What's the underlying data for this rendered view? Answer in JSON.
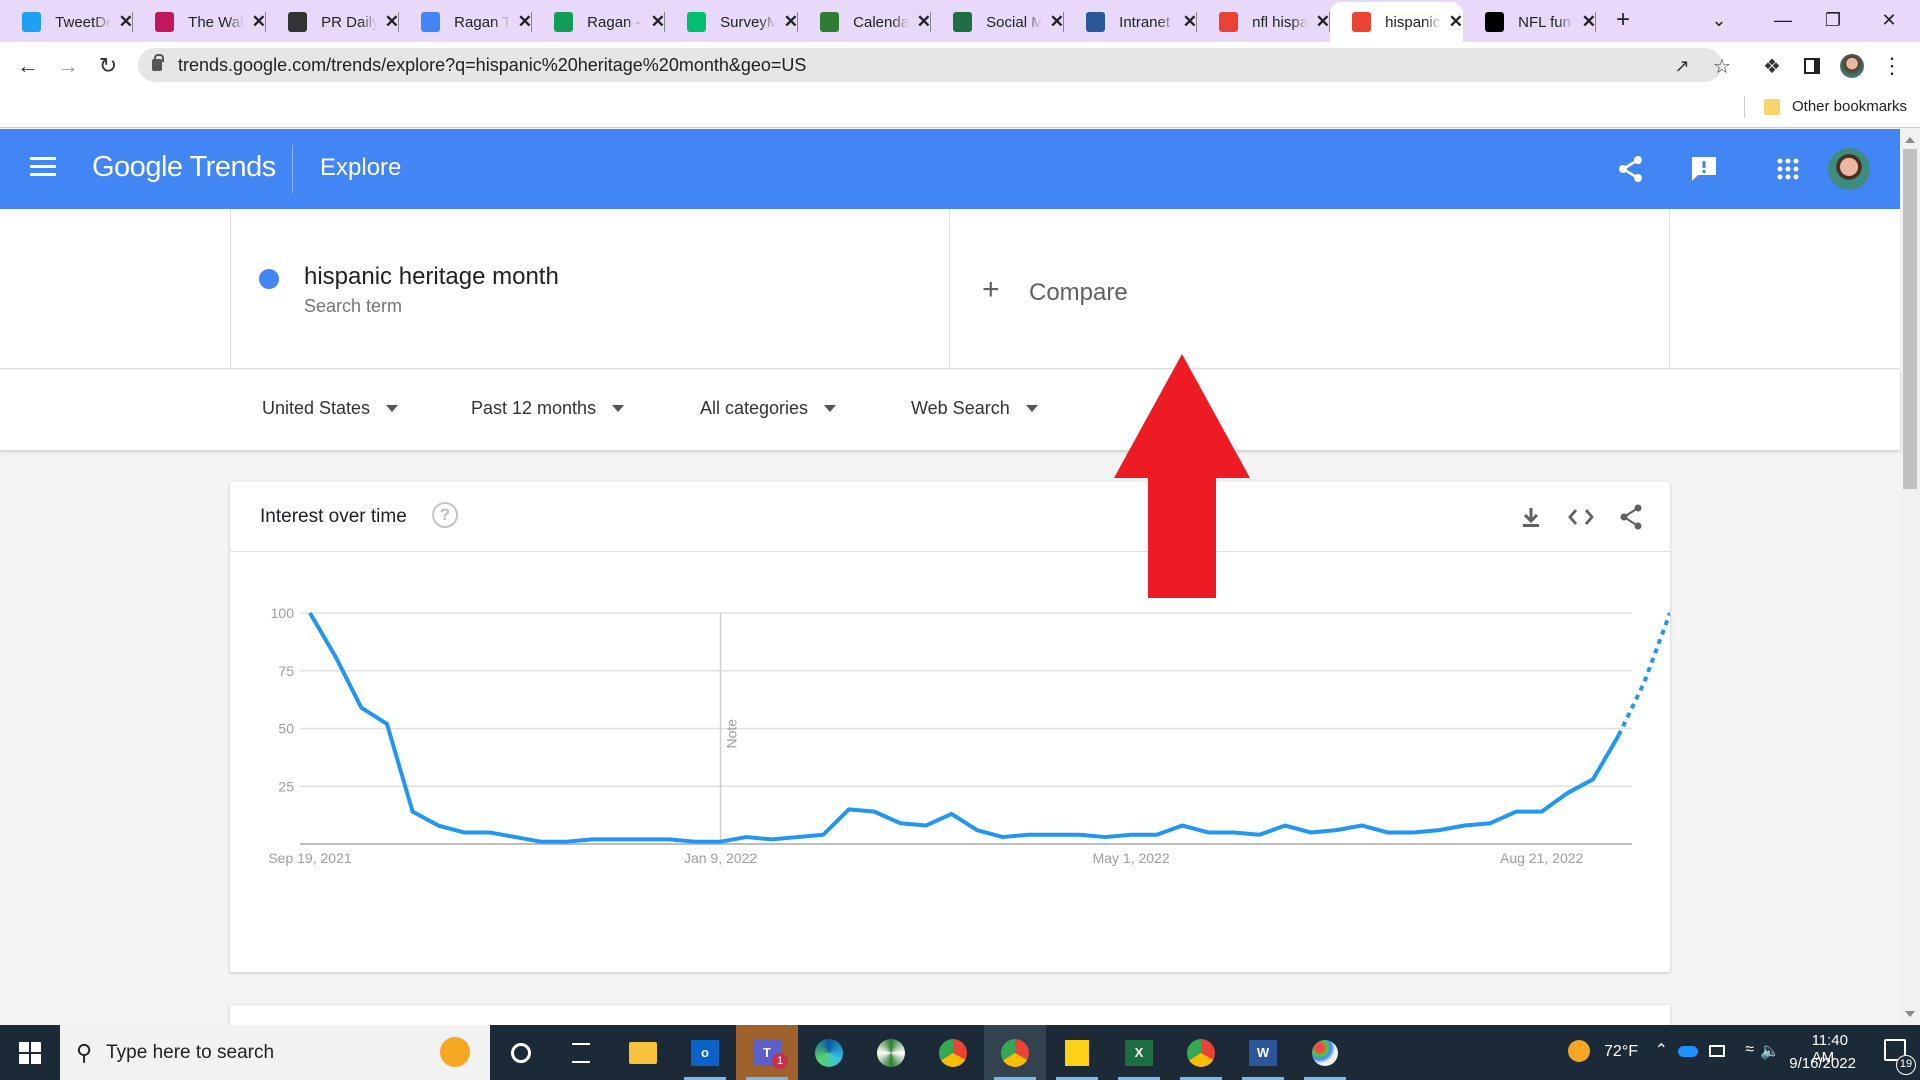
{
  "browser": {
    "tabs": [
      {
        "title": "TweetDeck",
        "icon": "twitter-icon",
        "color": "#1da1f2"
      },
      {
        "title": "The Wall",
        "icon": "p-logo-icon",
        "color": "#c2185b"
      },
      {
        "title": "PR Daily",
        "icon": "pr-daily-icon",
        "color": "#333333"
      },
      {
        "title": "Ragan Training",
        "icon": "google-docs-icon",
        "color": "#4285f4"
      },
      {
        "title": "Ragan - Google Drive",
        "icon": "google-drive-icon",
        "color": "#0f9d58"
      },
      {
        "title": "SurveyMonkey",
        "icon": "surveymonkey-icon",
        "color": "#00bf6f"
      },
      {
        "title": "Calendar",
        "icon": "leaf-icon",
        "color": "#2e7d32"
      },
      {
        "title": "Social Media",
        "icon": "excel-icon",
        "color": "#1d6f42"
      },
      {
        "title": "Intranet",
        "icon": "word-icon",
        "color": "#2b579a"
      },
      {
        "title": "nfl hispanic",
        "icon": "google-trends-icon",
        "color": "#ea4335"
      },
      {
        "title": "hispanic heritage month",
        "icon": "google-trends-icon",
        "color": "#ea4335",
        "active": true
      },
      {
        "title": "NFL fun",
        "icon": "pr-icon",
        "color": "#000000"
      }
    ],
    "url": "trends.google.com/trends/explore?q=hispanic%20heritage%20month&geo=US",
    "bookmarks": {
      "other": "Other bookmarks"
    }
  },
  "app": {
    "logo": "Google Trends",
    "section": "Explore",
    "brand_color": "#4285f4"
  },
  "search": {
    "term": "hispanic heritage month",
    "term_type": "Search term",
    "compare_label": "Compare",
    "term_color": "#4285f4"
  },
  "filters": {
    "region": "United States",
    "period": "Past 12 months",
    "category": "All categories",
    "property": "Web Search"
  },
  "card": {
    "title": "Interest over time"
  },
  "chart_data": {
    "type": "line",
    "title": "Interest over time",
    "xlabel": "",
    "ylabel": "",
    "ylim": [
      0,
      100
    ],
    "yticks": [
      25,
      50,
      75,
      100
    ],
    "xtick_labels": [
      {
        "label": "Sep 19, 2021",
        "index": 0
      },
      {
        "label": "Jan 9, 2022",
        "index": 16
      },
      {
        "label": "May 1, 2022",
        "index": 32
      },
      {
        "label": "Aug 21, 2022",
        "index": 48
      }
    ],
    "annotations": [
      {
        "label": "Note",
        "index": 16
      }
    ],
    "grid": true,
    "series": [
      {
        "name": "hispanic heritage month",
        "color": "#2196f3",
        "partial_from_index": 51,
        "values": [
          100,
          81,
          59,
          52,
          14,
          8,
          5,
          5,
          3,
          1,
          1,
          2,
          2,
          2,
          2,
          1,
          1,
          3,
          2,
          3,
          4,
          15,
          14,
          9,
          8,
          13,
          6,
          3,
          4,
          4,
          4,
          3,
          4,
          4,
          8,
          5,
          5,
          4,
          8,
          5,
          6,
          8,
          5,
          5,
          6,
          8,
          9,
          14,
          14,
          22,
          28,
          47,
          70,
          100
        ]
      }
    ]
  },
  "taskbar": {
    "search_placeholder": "Type here to search",
    "weather": "72°F",
    "time": "11:40 AM",
    "date": "9/16/2022",
    "notifications": "19",
    "teams_badge": "1"
  }
}
